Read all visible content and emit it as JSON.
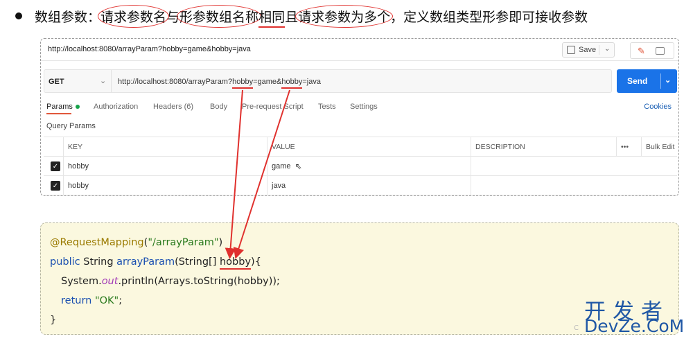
{
  "heading": {
    "bullet": "●",
    "p1": "数组参数：",
    "p2": "请求参数名",
    "p3": "与",
    "p4": "形参数组名称",
    "p5": "相同",
    "p6": "且",
    "p7": "请求参数为多个",
    "p8": "，定义数组类型形参即可接收参数"
  },
  "postman": {
    "tab_url": "http://localhost:8080/arrayParam?hobby=game&hobby=java",
    "save_label": "Save",
    "method": "GET",
    "url_base": "http://localhost:8080/arrayParam?",
    "url_p1_key": "hobby",
    "url_p1_val": "=game&",
    "url_p2_key": "hobby",
    "url_p2_val": "=java",
    "send_label": "Send",
    "tabs": {
      "params": "Params",
      "authorization": "Authorization",
      "headers": "Headers (6)",
      "body": "Body",
      "prerequest": "Pre-request Script",
      "tests": "Tests",
      "settings": "Settings",
      "cookies": "Cookies"
    },
    "query_params_title": "Query Params",
    "table": {
      "col_key": "KEY",
      "col_value": "VALUE",
      "col_description": "DESCRIPTION",
      "col_more": "•••",
      "col_bulk": "Bulk Edit",
      "rows": [
        {
          "key": "hobby",
          "value": "game",
          "description": ""
        },
        {
          "key": "hobby",
          "value": "java",
          "description": ""
        }
      ]
    }
  },
  "code": {
    "l1_ann": "@RequestMapping",
    "l1_open": "(",
    "l1_str": "\"/arrayParam\"",
    "l1_close": ")",
    "l2_kw": "public",
    "l2_type": " String ",
    "l2_meth": "arrayParam",
    "l2_args": "(String[] ",
    "l2_param": "hobby",
    "l2_end": "){",
    "l3_a": "System.",
    "l3_fld": "out",
    "l3_b": ".println(Arrays.toString(hobby));",
    "l4_kw": "return",
    "l4_str": " \"OK\"",
    "l4_end": ";",
    "l5": "}"
  },
  "watermark": {
    "cn": "开发者",
    "en": "DevZe.CoM",
    "faint": "C"
  },
  "colors": {
    "annotation_red": "#e0312e",
    "send_blue": "#1a73e8",
    "code_bg": "#fbf8df",
    "watermark_blue": "#1f57a5"
  }
}
